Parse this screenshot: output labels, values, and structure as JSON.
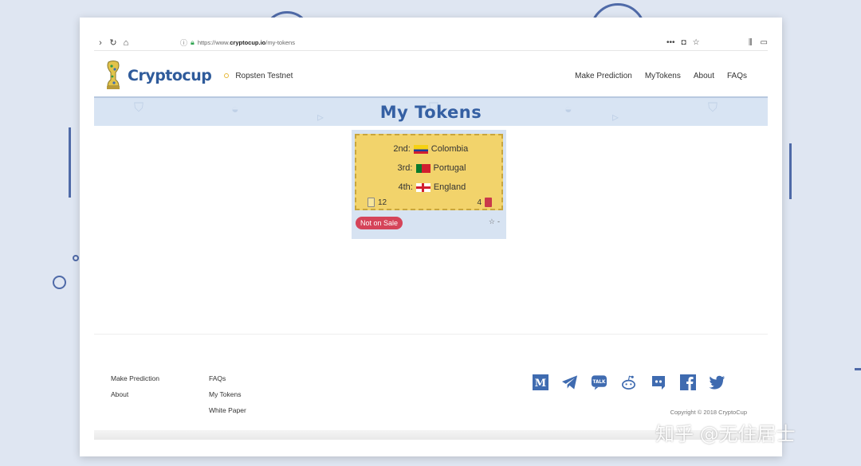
{
  "browser": {
    "url_prefix": "https://www.",
    "url_domain": "cryptocup.io",
    "url_path": "/my-tokens"
  },
  "site": {
    "logo_text": "Cryptocup",
    "network_label": "Ropsten Testnet",
    "nav": [
      {
        "label": "Make Prediction"
      },
      {
        "label": "MyTokens"
      },
      {
        "label": "About"
      },
      {
        "label": "FAQs"
      }
    ]
  },
  "banner": {
    "title": "My Tokens"
  },
  "token": {
    "rows": [
      {
        "place": "2nd:",
        "country": "Colombia"
      },
      {
        "place": "3rd:",
        "country": "Portugal"
      },
      {
        "place": "4th:",
        "country": "England"
      }
    ],
    "yellow_cards": "12",
    "red_cards": "4",
    "sale_status": "Not on Sale",
    "favorites": "-",
    "colors": {
      "card_bg": "#f2d36b",
      "badge": "#d54459"
    }
  },
  "footer": {
    "col1": [
      {
        "label": "Make Prediction"
      },
      {
        "label": "About"
      }
    ],
    "col2": [
      {
        "label": "FAQs"
      },
      {
        "label": "My Tokens"
      },
      {
        "label": "White Paper"
      }
    ],
    "socials": [
      "medium-icon",
      "telegram-icon",
      "kakaotalk-icon",
      "reddit-icon",
      "discord-icon",
      "facebook-icon",
      "twitter-icon"
    ],
    "copyright": "Copyright © 2018 CryptoCup"
  },
  "watermark": "知乎 @无住居士"
}
